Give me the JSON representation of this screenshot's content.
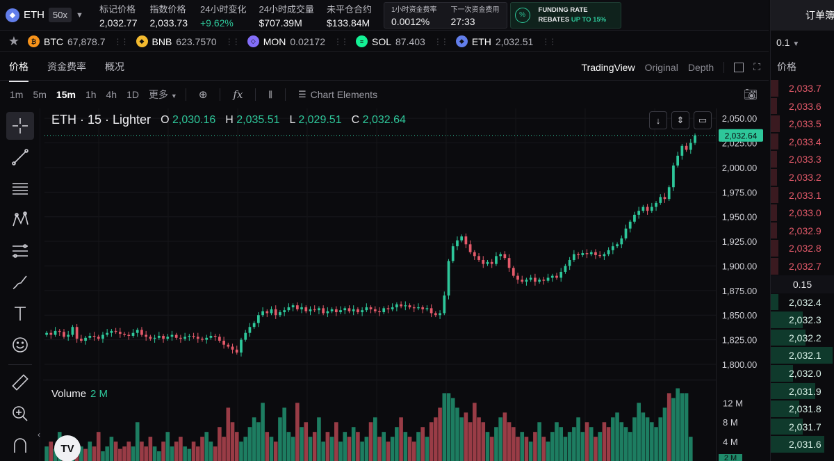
{
  "header": {
    "symbol": "ETH",
    "leverage": "50x",
    "stats": [
      {
        "label": "标记价格",
        "value": "2,032.77",
        "up": false
      },
      {
        "label": "指数价格",
        "value": "2,033.73",
        "up": false
      },
      {
        "label": "24小时变化",
        "value": "+9.62%",
        "up": true
      },
      {
        "label": "24小时成交量",
        "value": "$707.39M",
        "up": false
      },
      {
        "label": "未平仓合约",
        "value": "$133.84M",
        "up": false
      }
    ],
    "funding": [
      {
        "label": "1小时资金费率",
        "value": "0.0012%"
      },
      {
        "label": "下一次资金费用",
        "value": "27:33"
      }
    ],
    "promo": {
      "line1": "FUNDING RATE",
      "line2a": "REBATES ",
      "line2b": "UP TO 15%"
    }
  },
  "ticker": [
    {
      "name": "BTC",
      "price": "67,878.7",
      "color": "#f7931a",
      "glyph": "₿"
    },
    {
      "name": "BNB",
      "price": "623.7570",
      "color": "#f3ba2f",
      "glyph": "◆"
    },
    {
      "name": "MON",
      "price": "0.02172",
      "color": "#836ef9",
      "glyph": "◇"
    },
    {
      "name": "SOL",
      "price": "87.403",
      "color": "#14f195",
      "glyph": "≡"
    },
    {
      "name": "ETH",
      "price": "2,032.51",
      "color": "#627eea",
      "glyph": "◆"
    }
  ],
  "tabs": [
    "价格",
    "资金费率",
    "概况"
  ],
  "views": {
    "tradingview": "TradingView",
    "original": "Original",
    "depth": "Depth"
  },
  "timeframes": [
    "1m",
    "5m",
    "15m",
    "1h",
    "4h",
    "1D"
  ],
  "timeframe_active": "15m",
  "more_label": "更多",
  "chart_elements_label": "Chart Elements",
  "legend": {
    "title": "ETH · 15 · Lighter",
    "o_label": "O",
    "o": "2,030.16",
    "h_label": "H",
    "h": "2,035.51",
    "l_label": "L",
    "l": "2,029.51",
    "c_label": "C",
    "c": "2,032.64"
  },
  "volume": {
    "label": "Volume",
    "value": "2 M"
  },
  "tv_logo": "TV",
  "orderbook": {
    "title": "订单簿",
    "step": "0.1",
    "price_header": "价格",
    "asks": [
      "2,033.7",
      "2,033.6",
      "2,033.5",
      "2,033.4",
      "2,033.3",
      "2,033.2",
      "2,033.1",
      "2,033.0",
      "2,032.9",
      "2,032.8",
      "2,032.7"
    ],
    "ask_depth": [
      0.12,
      0.1,
      0.14,
      0.12,
      0.1,
      0.1,
      0.12,
      0.1,
      0.1,
      0.12,
      0.12
    ],
    "spread": "0.15",
    "bids": [
      "2,032.4",
      "2,032.3",
      "2,032.2",
      "2,032.1",
      "2,032.0",
      "2,031.9",
      "2,031.8",
      "2,031.7",
      "2,031.6"
    ],
    "bid_depth": [
      0.12,
      0.5,
      0.55,
      0.98,
      0.35,
      0.7,
      0.45,
      0.5,
      0.85
    ]
  },
  "chart_data": {
    "type": "candlestick",
    "price_axis": {
      "ticks": [
        2050,
        2025,
        2000,
        1975,
        1950,
        1925,
        1900,
        1875,
        1850,
        1825,
        1800
      ],
      "tick_labels": [
        "2,050.00",
        "2,025.00",
        "2,000.00",
        "1,975.00",
        "1,950.00",
        "1,925.00",
        "1,900.00",
        "1,875.00",
        "1,850.00",
        "1,825.00",
        "1,800.00"
      ],
      "range": [
        1788,
        2060
      ]
    },
    "last_price": 2032.64,
    "last_price_label": "2,032.64",
    "volume_axis": {
      "ticks": [
        12,
        8,
        4
      ],
      "tick_labels": [
        "12 M",
        "8 M",
        "4 M"
      ],
      "range": [
        0,
        16.5
      ],
      "current_label": "2 M"
    },
    "closes": [
      1832,
      1830,
      1834,
      1833,
      1828,
      1830,
      1838,
      1826,
      1824,
      1827,
      1829,
      1828,
      1826,
      1830,
      1832,
      1834,
      1833,
      1831,
      1830,
      1829,
      1832,
      1835,
      1830,
      1828,
      1826,
      1827,
      1829,
      1826,
      1828,
      1830,
      1827,
      1826,
      1828,
      1829,
      1828,
      1826,
      1825,
      1827,
      1829,
      1828,
      1824,
      1820,
      1818,
      1815,
      1812,
      1825,
      1832,
      1838,
      1842,
      1850,
      1854,
      1852,
      1856,
      1850,
      1853,
      1855,
      1858,
      1860,
      1856,
      1858,
      1854,
      1856,
      1855,
      1857,
      1852,
      1854,
      1856,
      1853,
      1855,
      1857,
      1854,
      1856,
      1853,
      1855,
      1858,
      1856,
      1854,
      1853,
      1857,
      1856,
      1858,
      1861,
      1859,
      1860,
      1858,
      1857,
      1858,
      1856,
      1857,
      1852,
      1850,
      1852,
      1870,
      1905,
      1920,
      1926,
      1930,
      1922,
      1914,
      1910,
      1906,
      1902,
      1904,
      1902,
      1910,
      1912,
      1908,
      1898,
      1890,
      1886,
      1884,
      1886,
      1888,
      1884,
      1886,
      1885,
      1888,
      1890,
      1888,
      1894,
      1900,
      1906,
      1912,
      1911,
      1913,
      1912,
      1914,
      1911,
      1910,
      1912,
      1916,
      1920,
      1922,
      1928,
      1938,
      1945,
      1952,
      1956,
      1960,
      1956,
      1960,
      1964,
      1970,
      1968,
      1980,
      2002,
      2012,
      2022,
      2018,
      2025,
      2032.64
    ],
    "volumes": [
      3,
      4,
      2.5,
      6,
      3,
      2,
      5,
      4,
      3,
      2.5,
      4,
      3,
      6,
      2,
      3,
      5,
      4,
      2.5,
      3,
      4,
      3,
      8,
      4,
      3,
      5,
      3,
      2,
      4,
      6,
      3,
      4,
      5,
      3,
      2.5,
      4,
      3,
      5,
      6,
      4,
      3,
      7,
      5,
      11,
      8,
      6,
      4,
      5,
      7,
      9,
      8,
      12,
      6,
      5,
      4,
      9,
      11,
      6,
      5,
      12,
      7,
      8,
      5,
      6,
      9,
      4,
      6,
      5,
      8,
      4,
      6,
      5,
      7,
      6,
      4,
      5,
      8,
      9,
      5,
      6,
      4,
      5,
      7,
      9,
      6,
      5,
      4,
      6,
      7,
      5,
      8,
      9,
      11,
      14,
      14,
      13,
      11,
      9,
      10,
      8,
      12,
      9,
      8,
      6,
      5,
      7,
      9,
      10,
      8,
      7,
      5,
      6,
      5,
      4,
      6,
      8,
      5,
      4,
      6,
      8,
      7,
      5,
      6,
      7,
      9,
      6,
      8,
      7,
      5,
      6,
      8,
      7,
      9,
      10,
      8,
      7,
      6,
      9,
      12,
      10,
      9,
      8,
      7,
      9,
      11,
      14,
      13,
      15,
      14,
      14,
      5
    ],
    "volume_colors_green": [
      0,
      2,
      3,
      6,
      8,
      10,
      13,
      14,
      15,
      20,
      21,
      25,
      26,
      28,
      29,
      32,
      33,
      37,
      38,
      45,
      46,
      47,
      48,
      49,
      50,
      52,
      54,
      55,
      56,
      57,
      59,
      61,
      63,
      64,
      66,
      68,
      69,
      71,
      73,
      74,
      76,
      78,
      80,
      81,
      83,
      86,
      88,
      92,
      93,
      94,
      95,
      96,
      102,
      104,
      105,
      110,
      112,
      114,
      116,
      117,
      118,
      119,
      120,
      121,
      122,
      123,
      124,
      126,
      128,
      131,
      132,
      133,
      134,
      135,
      136,
      137,
      138,
      139,
      140,
      141,
      142,
      143,
      145,
      146,
      147,
      148,
      149,
      150
    ]
  }
}
